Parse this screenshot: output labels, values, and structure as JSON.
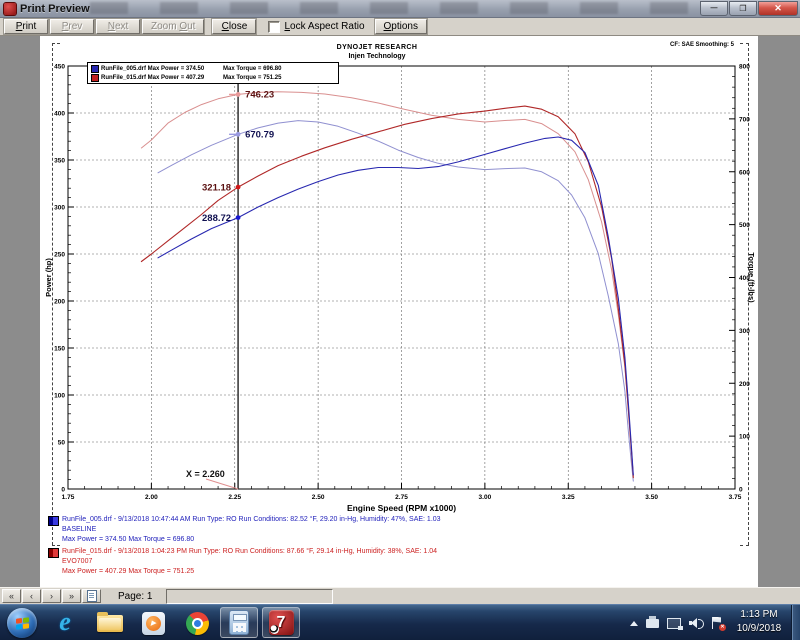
{
  "window": {
    "title": "Print Preview"
  },
  "toolbar": {
    "print_u": "P",
    "print_rest": "rint",
    "prev_u": "P",
    "prev_rest": "rev",
    "next_u": "N",
    "next_rest": "ext",
    "zoomout_pre": "Zoom ",
    "zoomout_u": "O",
    "zoomout_rest": "ut",
    "close_u": "C",
    "close_rest": "lose",
    "lock_u": "L",
    "lock_rest": "ock Aspect Ratio",
    "options_u": "O",
    "options_rest": "ptions"
  },
  "report": {
    "header_line1": "DYNOJET RESEARCH",
    "header_line2": "Injen Technology",
    "smoothing": "CF: SAE  Smoothing: 5"
  },
  "chart_data": {
    "type": "line",
    "title": "DYNOJET RESEARCH",
    "xlabel": "Engine Speed (RPM x1000)",
    "x_axis": {
      "min": 1.75,
      "max": 3.75,
      "major": 0.25,
      "minor": 0.05,
      "label": "Engine Speed (RPM x1000)"
    },
    "left_axis": {
      "min": 0,
      "max": 450,
      "major": 50,
      "minor": 10,
      "label": "Power (hp)"
    },
    "right_axis": {
      "min": 0,
      "max": 800,
      "major": 100,
      "minor": 20,
      "label": "Torque (ft-lbs)"
    },
    "grid": {
      "x_step": 0.25,
      "y_left_step": 50
    },
    "cursor": {
      "x": 2.26,
      "label": "X = 2.260",
      "leader_color": "#e09090"
    },
    "legend": [
      {
        "file": "RunFile_005.drf Max Power = 374.50",
        "torque": "Max Torque = 696.80",
        "color": "#2828b0"
      },
      {
        "file": "RunFile_015.drf Max Power = 407.29",
        "torque": "Max Torque = 751.25",
        "color": "#c02020"
      }
    ],
    "annotations": [
      {
        "text": "746.23",
        "axis": "right",
        "value": 746.23,
        "x": 2.26,
        "side": "right",
        "dot": "#e89a9a",
        "text_color": "#5a1010"
      },
      {
        "text": "670.79",
        "axis": "right",
        "value": 670.79,
        "x": 2.26,
        "side": "right",
        "dot": "#9a9ae0",
        "text_color": "#101050"
      },
      {
        "text": "321.18",
        "axis": "left",
        "value": 321.18,
        "x": 2.26,
        "side": "left",
        "dot": "#d01818",
        "text_color": "#5a1010"
      },
      {
        "text": "288.72",
        "axis": "left",
        "value": 288.72,
        "x": 2.26,
        "side": "left",
        "dot": "#1818d0",
        "text_color": "#101050"
      }
    ],
    "series": [
      {
        "name": "RunFile_015 Torque",
        "axis": "right",
        "color": "#d98f8f",
        "width": 1.0,
        "points": [
          [
            1.97,
            645
          ],
          [
            2.0,
            660
          ],
          [
            2.05,
            692
          ],
          [
            2.1,
            712
          ],
          [
            2.15,
            727
          ],
          [
            2.2,
            738
          ],
          [
            2.26,
            746.2
          ],
          [
            2.32,
            750
          ],
          [
            2.38,
            751.2
          ],
          [
            2.45,
            750
          ],
          [
            2.52,
            747
          ],
          [
            2.6,
            740
          ],
          [
            2.68,
            730
          ],
          [
            2.76,
            718
          ],
          [
            2.84,
            707
          ],
          [
            2.92,
            699
          ],
          [
            3.0,
            694
          ],
          [
            3.06,
            697
          ],
          [
            3.12,
            699
          ],
          [
            3.17,
            691
          ],
          [
            3.22,
            672
          ],
          [
            3.27,
            638
          ],
          [
            3.31,
            585
          ],
          [
            3.35,
            505
          ],
          [
            3.38,
            415
          ],
          [
            3.4,
            330
          ],
          [
            3.42,
            230
          ],
          [
            3.43,
            150
          ],
          [
            3.44,
            70
          ],
          [
            3.445,
            25
          ]
        ]
      },
      {
        "name": "RunFile_005 Torque",
        "axis": "right",
        "color": "#9090d0",
        "width": 1.0,
        "points": [
          [
            2.02,
            598
          ],
          [
            2.06,
            612
          ],
          [
            2.12,
            632
          ],
          [
            2.18,
            650
          ],
          [
            2.26,
            670.8
          ],
          [
            2.32,
            683
          ],
          [
            2.38,
            692
          ],
          [
            2.44,
            696.8
          ],
          [
            2.5,
            694
          ],
          [
            2.56,
            686
          ],
          [
            2.62,
            673
          ],
          [
            2.68,
            658
          ],
          [
            2.74,
            641
          ],
          [
            2.8,
            627
          ],
          [
            2.86,
            616
          ],
          [
            2.92,
            609
          ],
          [
            3.0,
            604
          ],
          [
            3.06,
            606
          ],
          [
            3.12,
            607
          ],
          [
            3.17,
            600
          ],
          [
            3.22,
            583
          ],
          [
            3.26,
            556
          ],
          [
            3.3,
            513
          ],
          [
            3.34,
            445
          ],
          [
            3.37,
            365
          ],
          [
            3.4,
            275
          ],
          [
            3.42,
            185
          ],
          [
            3.43,
            110
          ],
          [
            3.44,
            45
          ],
          [
            3.445,
            15
          ]
        ]
      },
      {
        "name": "RunFile_015 Power",
        "axis": "left",
        "color": "#b02828",
        "width": 1.1,
        "points": [
          [
            1.97,
            242
          ],
          [
            2.0,
            250
          ],
          [
            2.05,
            264
          ],
          [
            2.1,
            278
          ],
          [
            2.15,
            292
          ],
          [
            2.2,
            307
          ],
          [
            2.26,
            321.2
          ],
          [
            2.32,
            333
          ],
          [
            2.38,
            344
          ],
          [
            2.45,
            354
          ],
          [
            2.52,
            363
          ],
          [
            2.6,
            372
          ],
          [
            2.68,
            380
          ],
          [
            2.76,
            388
          ],
          [
            2.84,
            394
          ],
          [
            2.92,
            399
          ],
          [
            3.0,
            402
          ],
          [
            3.06,
            405
          ],
          [
            3.12,
            407.3
          ],
          [
            3.17,
            404
          ],
          [
            3.22,
            396
          ],
          [
            3.27,
            378
          ],
          [
            3.31,
            348
          ],
          [
            3.35,
            300
          ],
          [
            3.38,
            245
          ],
          [
            3.4,
            192
          ],
          [
            3.42,
            132
          ],
          [
            3.43,
            85
          ],
          [
            3.44,
            38
          ],
          [
            3.445,
            12
          ]
        ]
      },
      {
        "name": "RunFile_005 Power",
        "axis": "left",
        "color": "#2828b0",
        "width": 1.1,
        "points": [
          [
            2.02,
            246
          ],
          [
            2.06,
            254
          ],
          [
            2.12,
            266
          ],
          [
            2.18,
            277
          ],
          [
            2.26,
            288.7
          ],
          [
            2.32,
            300
          ],
          [
            2.38,
            310
          ],
          [
            2.44,
            319
          ],
          [
            2.5,
            327
          ],
          [
            2.56,
            334
          ],
          [
            2.62,
            339
          ],
          [
            2.68,
            342
          ],
          [
            2.74,
            342
          ],
          [
            2.8,
            341
          ],
          [
            2.86,
            343
          ],
          [
            2.92,
            348
          ],
          [
            3.0,
            356
          ],
          [
            3.06,
            362
          ],
          [
            3.12,
            368
          ],
          [
            3.18,
            373
          ],
          [
            3.22,
            374.5
          ],
          [
            3.26,
            371
          ],
          [
            3.3,
            358
          ],
          [
            3.34,
            323
          ],
          [
            3.37,
            268
          ],
          [
            3.4,
            203
          ],
          [
            3.42,
            140
          ],
          [
            3.43,
            92
          ],
          [
            3.44,
            42
          ],
          [
            3.445,
            15
          ]
        ]
      }
    ]
  },
  "footer_runs": [
    {
      "color": "#2222bb",
      "line1": "RunFile_005.drf - 9/13/2018 10:47:44 AM  Run Type: RO  Run Conditions: 82.52 °F, 29.20 in-Hg,  Humidity:  47%, SAE: 1.03",
      "line2": "BASELINE",
      "line3": "Max Power = 374.50  Max Torque = 696.80"
    },
    {
      "color": "#cc2222",
      "line1": "RunFile_015.drf - 9/13/2018 1:04:23 PM  Run Type: RO  Run Conditions: 87.66 °F, 29.14 in-Hg,  Humidity:  38%, SAE: 1.04",
      "line2": "EVO7007",
      "line3": "Max Power = 407.29  Max Torque = 751.25"
    }
  ],
  "pager": {
    "first": "«",
    "prev": "‹",
    "next": "›",
    "last": "»",
    "page_label": "Page: 1"
  },
  "taskbar": {
    "app7_label": "7",
    "clock_time": "1:13 PM",
    "clock_date": "10/9/2018"
  }
}
